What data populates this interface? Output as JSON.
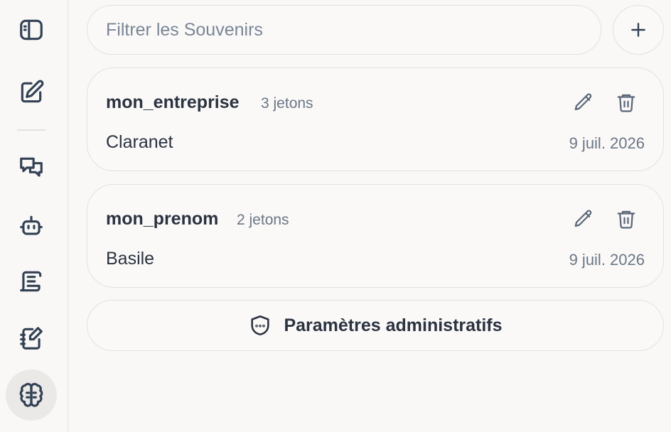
{
  "sidebar": {
    "items": [
      {
        "icon": "sidebar-toggle-icon"
      },
      {
        "icon": "new-note-icon"
      },
      {
        "icon": "chat-bubbles-icon"
      },
      {
        "icon": "robot-icon"
      },
      {
        "icon": "scroll-icon"
      },
      {
        "icon": "notebook-edit-icon"
      },
      {
        "icon": "brain-icon",
        "active": true
      }
    ]
  },
  "search": {
    "placeholder": "Filtrer les Souvenirs",
    "value": ""
  },
  "memories": [
    {
      "key": "mon_entreprise",
      "tokens": "3 jetons",
      "value": "Claranet",
      "date": "9 juil. 2026"
    },
    {
      "key": "mon_prenom",
      "tokens": "2 jetons",
      "value": "Basile",
      "date": "9 juil. 2026"
    }
  ],
  "admin": {
    "label": "Paramètres administratifs",
    "icon": "shield-dots-icon"
  },
  "colors": {
    "background": "#f9f8f7",
    "text": "#2b3340",
    "muted": "#6b7686",
    "border": "#e3e1de",
    "active_bg": "#ebe9e7"
  }
}
